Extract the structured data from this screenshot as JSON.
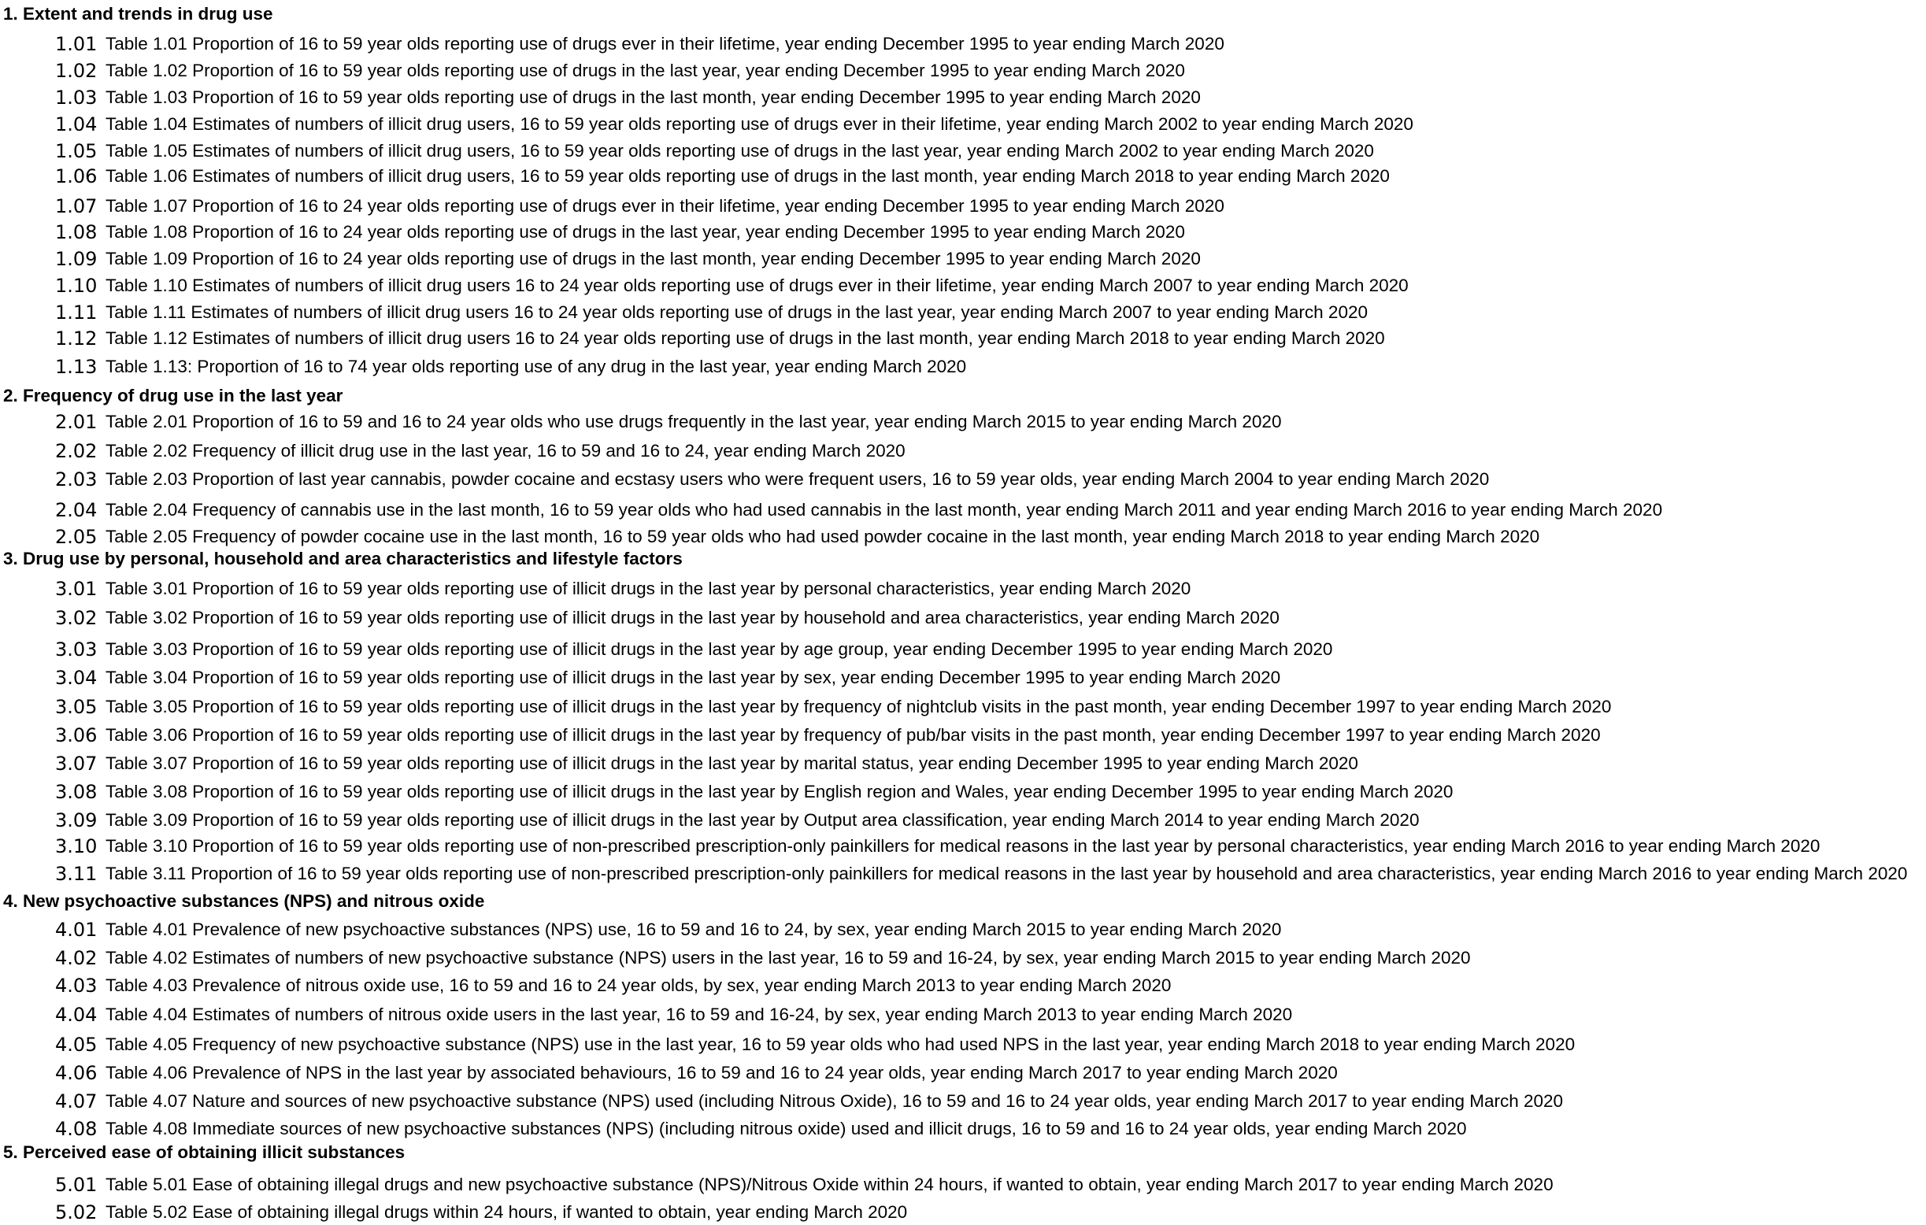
{
  "sections": [
    {
      "title": "1. Extent and trends in drug use",
      "items": [
        {
          "num": "1.01",
          "text": "Table 1.01  Proportion of 16 to 59 year olds reporting use of drugs ever in their lifetime, year ending December 1995 to year ending March 2020"
        },
        {
          "num": "1.02",
          "text": "Table 1.02  Proportion of 16 to 59 year olds reporting use of drugs in the last year, year ending December 1995 to year ending March 2020"
        },
        {
          "num": "1.03",
          "text": "Table 1.03  Proportion of 16 to 59 year olds reporting use of drugs in the last month, year ending December 1995 to year ending March 2020"
        },
        {
          "num": "1.04",
          "text": "Table 1.04  Estimates of numbers of illicit drug users, 16 to 59 year olds reporting use of drugs ever in their lifetime,  year ending March 2002 to year ending March 2020"
        },
        {
          "num": "1.05",
          "text": "Table 1.05  Estimates of numbers of illicit drug users, 16 to 59 year olds reporting use of drugs in the last year,  year ending March 2002 to year ending March 2020"
        },
        {
          "num": "1.06",
          "text": "Table 1.06  Estimates of numbers of illicit drug users, 16 to 59 year olds reporting use of drugs in the last month, year ending March 2018 to year ending March 2020"
        },
        {
          "num": "1.07",
          "text": "Table 1.07  Proportion of 16 to 24 year olds reporting use of drugs ever in their lifetime, year ending December 1995 to year ending March 2020"
        },
        {
          "num": "1.08",
          "text": "Table 1.08  Proportion of 16 to 24 year olds reporting use of drugs in the last year, year ending December 1995 to year ending March 2020"
        },
        {
          "num": "1.09",
          "text": "Table 1.09  Proportion of 16 to 24 year olds reporting use of drugs in the last month, year ending December 1995 to year ending March 2020"
        },
        {
          "num": "1.10",
          "text": "Table 1.10  Estimates of numbers of illicit drug users 16 to 24 year olds reporting use of drugs ever in their lifetime, year ending March 2007  to year ending March 2020"
        },
        {
          "num": "1.11",
          "text": "Table 1.11  Estimates of numbers of illicit drug users 16 to 24 year olds reporting use of drugs in the last year, year ending March 2007  to year ending March 2020"
        },
        {
          "num": "1.12",
          "text": "Table 1.12  Estimates of numbers of illicit drug users 16 to 24 year olds reporting use of drugs in the last month, year ending March 2018 to year ending March 2020"
        },
        {
          "num": "1.13",
          "text": "Table 1.13:  Proportion of 16 to 74 year olds reporting use of any drug in the last year, year ending March 2020"
        }
      ]
    },
    {
      "title": "2. Frequency of  drug use in the last year",
      "items": [
        {
          "num": "2.01",
          "text": "Table 2.01 Proportion of 16 to 59 and 16 to 24 year olds who use drugs frequently in the last year, year ending March 2015 to year ending March 2020"
        },
        {
          "num": "2.02",
          "text": "Table 2.02 Frequency of illicit drug use in the last year, 16 to 59 and 16 to 24, year ending March 2020"
        },
        {
          "num": "2.03",
          "text": "Table 2.03 Proportion of last year cannabis, powder cocaine and ecstasy users who were frequent users, 16 to 59 year olds, year ending March 2004 to year ending March 2020"
        },
        {
          "num": "2.04",
          "text": "Table 2.04 Frequency of cannabis use in the last month, 16 to 59 year olds who had used cannabis in the last month, year ending March 2011 and year ending March 2016 to year ending March 2020"
        },
        {
          "num": "2.05",
          "text": "Table 2.05 Frequency of powder cocaine use in the last month, 16 to 59 year olds who had used powder cocaine in the last month, year ending March 2018 to year ending March 2020"
        }
      ]
    },
    {
      "title": "3. Drug use by personal, household and area characteristics and lifestyle factors",
      "items": [
        {
          "num": "3.01",
          "text": "Table 3.01 Proportion of 16 to 59 year olds reporting use of illicit drugs in the last year by personal characteristics, year ending March 2020"
        },
        {
          "num": "3.02",
          "text": "Table 3.02  Proportion of 16 to 59 year olds reporting use of illicit drugs in the last year by household and area characteristics, year ending March 2020"
        },
        {
          "num": "3.03",
          "text": "Table 3.03  Proportion of 16 to 59 year olds reporting use of illicit drugs in the last year by age group, year ending December 1995 to year ending March 2020"
        },
        {
          "num": "3.04",
          "text": "Table 3.04  Proportion of 16 to 59 year olds reporting use of illicit drugs in the last year by sex, year ending December 1995 to year ending March 2020"
        },
        {
          "num": "3.05",
          "text": "Table 3.05  Proportion of 16 to 59 year olds reporting use of illicit drugs in the last year by frequency of nightclub visits in the past month, year ending December 1997 to year ending March 2020"
        },
        {
          "num": "3.06",
          "text": "Table 3.06  Proportion of 16 to 59 year olds reporting use of illicit drugs in the last year by frequency of pub/bar visits in the past month, year ending December 1997 to year ending March 2020"
        },
        {
          "num": "3.07",
          "text": "Table 3.07  Proportion of 16 to 59 year olds reporting use of illicit drugs in the last year by marital status, year ending December 1995 to year ending March 2020"
        },
        {
          "num": "3.08",
          "text": "Table 3.08  Proportion of 16 to 59 year olds reporting use of illicit drugs in the last year by English region and Wales, year ending December 1995 to year ending March 2020"
        },
        {
          "num": "3.09",
          "text": "Table 3.09  Proportion of 16 to 59 year olds reporting use of illicit drugs in the last year by Output area classification, year ending March 2014 to year ending March 2020"
        },
        {
          "num": "3.10",
          "text": "Table 3.10  Proportion of 16 to 59 year olds reporting use of non-prescribed prescription-only painkillers for medical reasons in the last year by personal characteristics, year ending March 2016 to year ending March 2020"
        },
        {
          "num": "3.11",
          "text": "Table 3.11  Proportion of 16 to 59 year olds reporting use of non-prescribed prescription-only painkillers for medical reasons in the last year by household and area characteristics, year ending March 2016 to year ending March 2020"
        }
      ]
    },
    {
      "title": "4. New psychoactive substances (NPS) and nitrous oxide",
      "items": [
        {
          "num": "4.01",
          "text": "Table 4.01  Prevalence of new psychoactive substances (NPS) use, 16 to 59 and 16 to 24, by sex, year ending March 2015 to year ending March 2020"
        },
        {
          "num": "4.02",
          "text": "Table 4.02  Estimates of numbers of new psychoactive substance (NPS) users in the last year, 16 to 59 and 16-24, by sex, year ending March 2015 to year ending March 2020"
        },
        {
          "num": "4.03",
          "text": "Table 4.03  Prevalence of nitrous oxide use, 16 to 59 and 16 to 24 year olds, by sex, year ending March 2013 to year ending March 2020"
        },
        {
          "num": "4.04",
          "text": "Table 4.04  Estimates of numbers of nitrous oxide users in the last year, 16 to 59 and 16-24, by sex, year ending March 2013 to year ending March 2020"
        },
        {
          "num": "4.05",
          "text": "Table 4.05  Frequency of new psychoactive substance (NPS) use in the last year, 16 to 59 year olds who had used NPS in the last year, year ending March 2018 to year ending March 2020"
        },
        {
          "num": "4.06",
          "text": "Table 4.06  Prevalence of NPS in the last year by associated behaviours, 16 to 59 and 16 to 24 year olds, year ending March 2017 to year ending March 2020"
        },
        {
          "num": "4.07",
          "text": "Table 4.07  Nature and sources of new psychoactive substance (NPS) used (including Nitrous Oxide), 16 to 59 and 16 to 24 year olds, year ending March 2017 to year ending March 2020"
        },
        {
          "num": "4.08",
          "text": "Table 4.08  Immediate sources of new psychoactive substances (NPS) (including nitrous oxide) used and illicit drugs, 16 to 59 and 16 to 24 year olds, year ending March 2020"
        }
      ]
    },
    {
      "title": "5. Perceived ease of obtaining illicit substances",
      "items": [
        {
          "num": "5.01",
          "text": "Table 5.01  Ease of obtaining illegal drugs and new psychoactive substance (NPS)/Nitrous Oxide within 24 hours, if wanted to obtain, year ending March 2017 to year ending March 2020"
        },
        {
          "num": "5.02",
          "text": "Table 5.02  Ease of obtaining illegal drugs within 24 hours, if wanted to obtain, year ending March 2020"
        }
      ]
    }
  ]
}
